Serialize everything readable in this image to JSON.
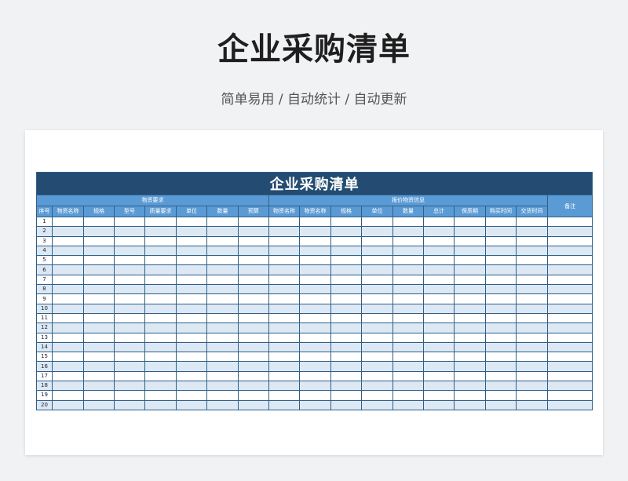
{
  "page": {
    "title": "企业采购清单",
    "subtitle": "简单易用 / 自动统计 / 自动更新"
  },
  "sheet": {
    "title": "企业采购清单",
    "group_headers": [
      "物资要求",
      "报价物资信息",
      "备注"
    ],
    "columns": [
      "序号",
      "物资名称",
      "规格",
      "型号",
      "质量要求",
      "单位",
      "数量",
      "预算",
      "物资名称",
      "物资名称",
      "规格",
      "单位",
      "数量",
      "总计",
      "保质期",
      "购买时间",
      "交货时间"
    ],
    "row_numbers": [
      "1",
      "2",
      "3",
      "4",
      "5",
      "6",
      "7",
      "8",
      "9",
      "10",
      "11",
      "12",
      "13",
      "14",
      "15",
      "16",
      "17",
      "18",
      "19",
      "20"
    ]
  },
  "colors": {
    "title_bar": "#244c72",
    "header": "#5b9bd5",
    "stripe": "#dce8f4",
    "border": "#2f5f86"
  }
}
